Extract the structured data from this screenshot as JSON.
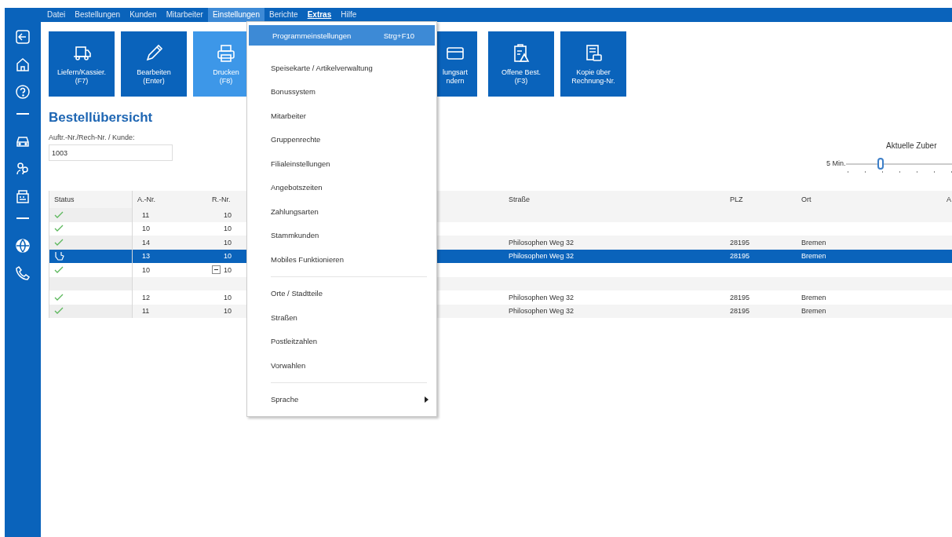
{
  "menubar": [
    {
      "label": "Datei",
      "open": false,
      "emphasized": false
    },
    {
      "label": "Bestellungen",
      "open": false,
      "emphasized": false
    },
    {
      "label": "Kunden",
      "open": false,
      "emphasized": false
    },
    {
      "label": "Mitarbeiter",
      "open": false,
      "emphasized": false
    },
    {
      "label": "Einstellungen",
      "open": true,
      "emphasized": false
    },
    {
      "label": "Berichte",
      "open": false,
      "emphasized": false
    },
    {
      "label": "Extras",
      "open": false,
      "emphasized": true
    },
    {
      "label": "Hilfe",
      "open": false,
      "emphasized": false
    }
  ],
  "toolbar": [
    {
      "lines": [
        "Liefern/Kassier.",
        "(F7)"
      ],
      "selected": false
    },
    {
      "lines": [
        "Bearbeiten",
        "(Enter)"
      ],
      "selected": false
    },
    {
      "lines": [
        "Drucken",
        "(F8)"
      ],
      "selected": true
    },
    {
      "lines": [
        "lungsart",
        "ndern"
      ],
      "selected": false
    },
    {
      "lines": [
        "Offene Best.",
        "(F3)"
      ],
      "selected": false
    },
    {
      "lines": [
        "Kopie über",
        "Rechnung-Nr."
      ],
      "selected": false
    }
  ],
  "title": "Bestellübersicht",
  "filter": {
    "label": "Auftr.-Nr./Rech-Nr. / Kunde:",
    "value": "1003"
  },
  "slider": {
    "title": "Aktuelle Zuber",
    "min_label": "5 Min.",
    "level": 0.25
  },
  "table": {
    "columns": [
      "Status",
      "A.-Nr.",
      "R.-Nr.",
      "Straße",
      "PLZ",
      "Ort",
      "A"
    ],
    "rows": [
      {
        "kind": "done",
        "selected": false,
        "a_nr": "11",
        "r_nr": "10"
      },
      {
        "kind": "done",
        "selected": false,
        "a_nr": "10",
        "r_nr": "10"
      },
      {
        "kind": "done",
        "selected": false,
        "a_nr": "14",
        "r_nr": "10",
        "street": "Philosophen Weg 32",
        "plz": "28195",
        "city": "Bremen"
      },
      {
        "kind": "editing",
        "selected": true,
        "a_nr": "13",
        "r_nr": "10",
        "street": "Philosophen Weg 32",
        "plz": "28195",
        "city": "Bremen"
      },
      {
        "kind": "group",
        "expanded": true,
        "selected": false,
        "a_nr": "10",
        "r_nr": "10"
      },
      {
        "kind": "empty",
        "selected": false
      },
      {
        "kind": "done",
        "selected": false,
        "a_nr": "12",
        "r_nr": "10",
        "street": "Philosophen Weg 32",
        "plz": "28195",
        "city": "Bremen"
      },
      {
        "kind": "done",
        "selected": false,
        "a_nr": "11",
        "r_nr": "10",
        "street": "Philosophen Weg 32",
        "plz": "28195",
        "city": "Bremen"
      }
    ]
  },
  "dropdown": {
    "items": [
      {
        "kind": "item",
        "label": "Programmeinstellungen",
        "shortcut": "Strg+F10",
        "selected": true
      },
      {
        "kind": "separator"
      },
      {
        "kind": "item",
        "label": "Speisekarte / Artikelverwaltung",
        "selected": false
      },
      {
        "kind": "item",
        "label": "Bonussystem",
        "selected": false
      },
      {
        "kind": "item",
        "label": "Mitarbeiter",
        "selected": false
      },
      {
        "kind": "item",
        "label": "Gruppenrechte",
        "selected": false
      },
      {
        "kind": "item",
        "label": "Filialeinstellungen",
        "selected": false
      },
      {
        "kind": "item",
        "label": "Angebotszeiten",
        "selected": false
      },
      {
        "kind": "item",
        "label": "Zahlungsarten",
        "selected": false
      },
      {
        "kind": "item",
        "label": "Stammkunden",
        "selected": false
      },
      {
        "kind": "item",
        "label": "Mobiles Funktionieren",
        "selected": false
      },
      {
        "kind": "separator"
      },
      {
        "kind": "item",
        "label": "Orte / Stadtteile",
        "selected": false
      },
      {
        "kind": "item",
        "label": "Straßen",
        "selected": false
      },
      {
        "kind": "item",
        "label": "Postleitzahlen",
        "selected": false
      },
      {
        "kind": "item",
        "label": "Vorwahlen",
        "selected": false
      },
      {
        "kind": "separator"
      },
      {
        "kind": "submenu",
        "label": "Sprache",
        "selected": false
      }
    ]
  }
}
